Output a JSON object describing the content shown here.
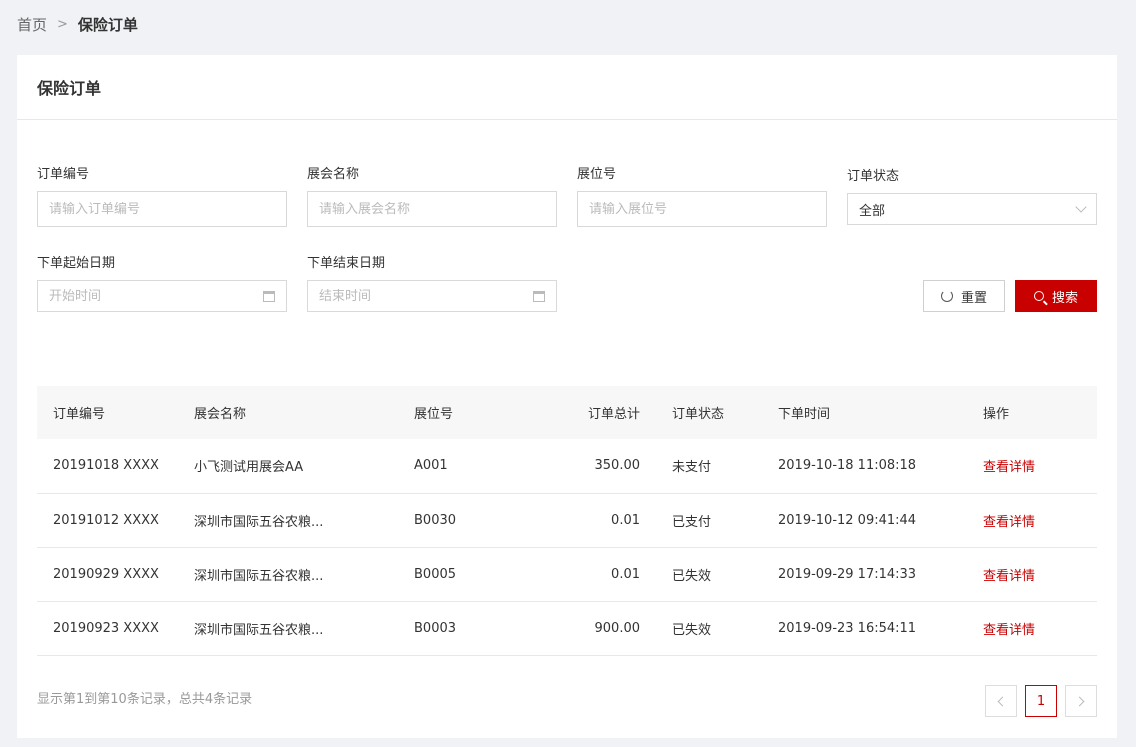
{
  "breadcrumb": {
    "home": "首页",
    "separator": ">",
    "current": "保险订单"
  },
  "card": {
    "title": "保险订单"
  },
  "filters": {
    "order_no": {
      "label": "订单编号",
      "placeholder": "请输入订单编号"
    },
    "expo_name": {
      "label": "展会名称",
      "placeholder": "请输入展会名称"
    },
    "booth_no": {
      "label": "展位号",
      "placeholder": "请输入展位号"
    },
    "order_status": {
      "label": "订单状态",
      "value": "全部"
    },
    "start_date": {
      "label": "下单起始日期",
      "placeholder": "开始时间"
    },
    "end_date": {
      "label": "下单结束日期",
      "placeholder": "结束时间"
    }
  },
  "buttons": {
    "reset": "重置",
    "search": "搜索"
  },
  "table": {
    "headers": [
      "订单编号",
      "展会名称",
      "展位号",
      "订单总计",
      "订单状态",
      "下单时间",
      "操作"
    ],
    "rows": [
      {
        "id": "20191018 XXXX",
        "expo": "小飞测试用展会AA",
        "booth": "A001",
        "total": "350.00",
        "status": "未支付",
        "status_type": "unpaid",
        "time": "2019-10-18 11:08:18",
        "action": "查看详情"
      },
      {
        "id": "20191012 XXXX",
        "expo": "深圳市国际五谷农粮...",
        "booth": "B0030",
        "total": "0.01",
        "status": "已支付",
        "status_type": "paid",
        "time": "2019-10-12 09:41:44",
        "action": "查看详情"
      },
      {
        "id": "20190929 XXXX",
        "expo": "深圳市国际五谷农粮...",
        "booth": "B0005",
        "total": "0.01",
        "status": "已失效",
        "status_type": "expired",
        "time": "2019-09-29 17:14:33",
        "action": "查看详情"
      },
      {
        "id": "20190923 XXXX",
        "expo": "深圳市国际五谷农粮...",
        "booth": "B0003",
        "total": "900.00",
        "status": "已失效",
        "status_type": "expired",
        "time": "2019-09-23 16:54:11",
        "action": "查看详情"
      }
    ]
  },
  "footer": {
    "summary": "显示第1到第10条记录，总共4条记录",
    "current_page": "1"
  },
  "colors": {
    "accent": "#c80000",
    "background": "#f0f2f5"
  },
  "icons": {
    "reset": "refresh-icon",
    "search": "search-icon",
    "calendar": "calendar-icon",
    "dropdown": "chevron-down-icon"
  }
}
